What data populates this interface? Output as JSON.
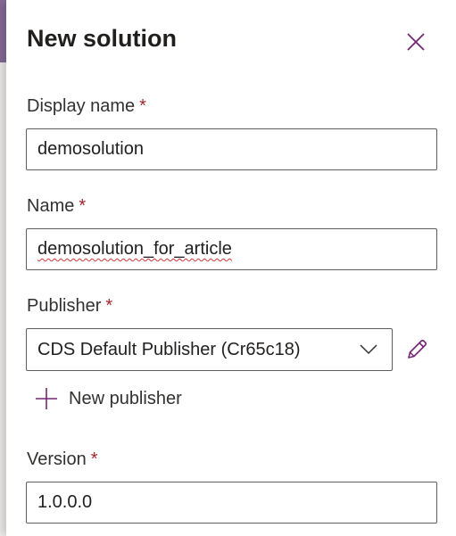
{
  "panel": {
    "title": "New solution",
    "close_icon": "close-icon"
  },
  "fields": {
    "display_name": {
      "label": "Display name",
      "required_mark": "*",
      "value": "demosolution"
    },
    "name": {
      "label": "Name",
      "required_mark": "*",
      "value": "demosolution_for_article"
    },
    "publisher": {
      "label": "Publisher",
      "required_mark": "*",
      "selected": "CDS Default Publisher (Cr65c18)",
      "dropdown_icon": "chevron-down-icon",
      "edit_icon": "pencil-icon"
    },
    "new_publisher": {
      "label": "New publisher",
      "icon": "plus-icon"
    },
    "version": {
      "label": "Version",
      "required_mark": "*",
      "value": "1.0.0.0"
    }
  },
  "colors": {
    "accent": "#742774",
    "required": "#a4262c",
    "border": "#605e5c",
    "text": "#201f1e"
  }
}
